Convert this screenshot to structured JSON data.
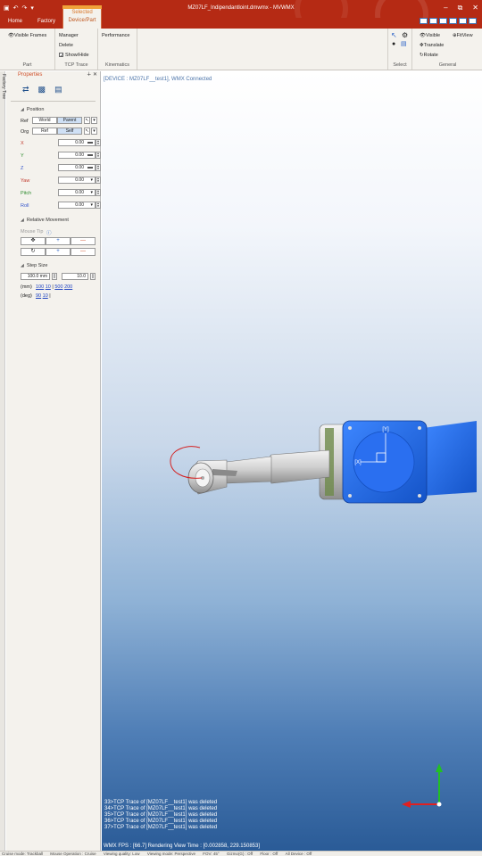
{
  "window": {
    "title": "MZ07LF_Indipendantloint.dmwmx - MVWMX"
  },
  "ribbon": {
    "tabs": {
      "home": "Home",
      "factory": "Factory"
    },
    "context_tab": {
      "group": "Selected",
      "label": "Device/Part"
    },
    "part": {
      "visible_frames": "Visible Frames",
      "manager": "Manager",
      "delete": "Delete",
      "label": "Part"
    },
    "tcp_trace": {
      "show_hide": "Show/Hide",
      "show_hide_checked": true,
      "label": "TCP Trace"
    },
    "kinematics": {
      "performance": "Performance",
      "label": "Kinematics"
    },
    "select": {
      "label": "Select"
    },
    "general": {
      "visible": "Visible",
      "translate": "Translate",
      "rotate": "Rotate",
      "fitview": "FitView",
      "label": "General"
    }
  },
  "left_strip": {
    "label": "Factory Tree"
  },
  "properties": {
    "title": "Properties",
    "position": {
      "header": "Position",
      "ref_label": "Ref",
      "ref_options": [
        "World",
        "Parent"
      ],
      "ref_selected": "Parent",
      "org_label": "Org",
      "org_options": [
        "Ref",
        "Self"
      ],
      "org_selected": "Self",
      "fields": [
        {
          "name": "X",
          "value": "0.00",
          "color": "#c0392b"
        },
        {
          "name": "Y",
          "value": "0.00",
          "color": "#2e8b2e"
        },
        {
          "name": "Z",
          "value": "0.00",
          "color": "#3355cc"
        },
        {
          "name": "Yaw",
          "value": "0.00",
          "color": "#c0392b"
        },
        {
          "name": "Pitch",
          "value": "0.00",
          "color": "#2e8b2e"
        },
        {
          "name": "Roll",
          "value": "0.00",
          "color": "#3355cc"
        }
      ]
    },
    "relative_movement": {
      "header": "Relative Movement",
      "mouse_tip": "Mouse Tip",
      "plus": "+",
      "minus": "—"
    },
    "step_size": {
      "header": "Step Size",
      "linear_value": "100.0",
      "linear_unit": "mm",
      "angular_value": "10.0",
      "mm_label": "(mm)",
      "mm_presets": [
        "100",
        "10",
        "500",
        "200"
      ],
      "deg_label": "(deg)",
      "deg_presets": [
        "90",
        "10"
      ]
    }
  },
  "viewport": {
    "status": "[DEVICE : MZ07LF__test1], WMX Connected",
    "label_y": "[Y]",
    "label_x": "[X]",
    "log_lines": [
      "33>TCP Trace of [MZ07LF__test1] was deleted",
      "34>TCP Trace of [MZ07LF__test1] was deleted",
      "35>TCP Trace of [MZ07LF__test1] was deleted",
      "36>TCP Trace of [MZ07LF__test1] was deleted",
      "37>TCP Trace of [MZ07LF__test1] was deleted"
    ],
    "fps": "WMX FPS : [66.7] Rendering View Time : [0.002858, 229.150853]"
  },
  "statusbar": {
    "items": [
      "Cruise mode: Trackball",
      "Mouse Operation : Cruise",
      "Viewing quality: Low",
      "Viewing mode: Perspective",
      "FOV: 45°",
      "Gizmo(G) : Off",
      "Floor : Off",
      "All Device : Off"
    ]
  },
  "colors": {
    "titlebar": "#b52a14",
    "accent_orange": "#d9782d",
    "robot_blue": "#2166e6",
    "robot_gray": "#d7d7d7"
  }
}
